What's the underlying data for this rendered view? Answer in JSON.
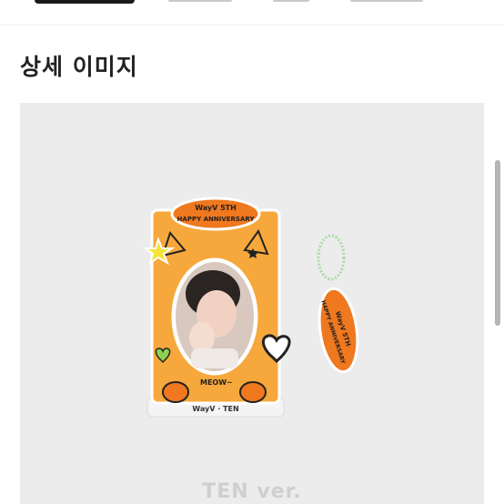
{
  "section": {
    "title": "상세 이미지"
  },
  "product_image": {
    "frame_banner": [
      "WayV 5TH",
      "HAPPY ANNIVERSARY"
    ],
    "frame_cat_text": "MEOW~",
    "frame_base_text": "WayV · TEN",
    "keyring_text": [
      "WayV 5TH",
      "HAPPY ANNIVERSARY"
    ],
    "version_label": "TEN ver."
  },
  "colors": {
    "accent_orange": "#f59a2a",
    "frame_fill": "#f6a83c",
    "panel_bg": "#ececec"
  }
}
